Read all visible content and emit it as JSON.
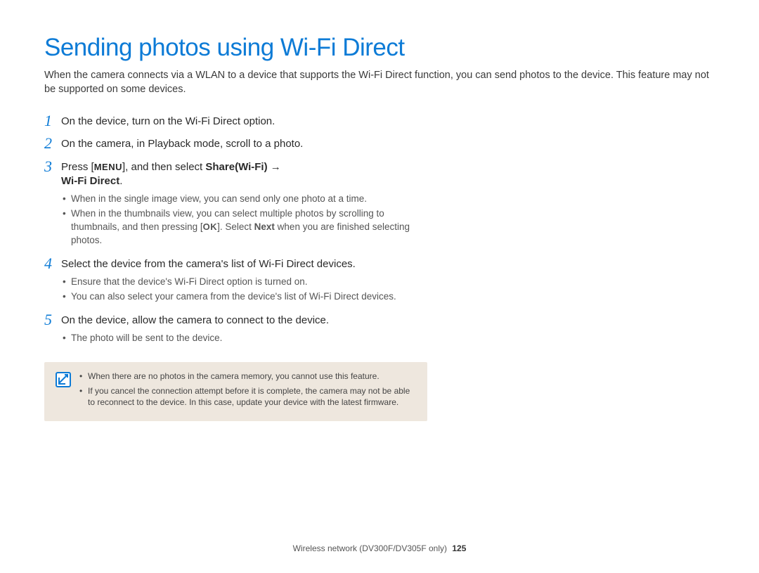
{
  "title": "Sending photos using Wi-Fi Direct",
  "intro": "When the camera connects via a WLAN to a device that supports the Wi-Fi Direct function, you can send photos to the device. This feature may not be supported on some devices.",
  "steps": {
    "s1": {
      "num": "1",
      "text": "On the device, turn on the Wi-Fi Direct option."
    },
    "s2": {
      "num": "2",
      "text": "On the camera, in Playback mode, scroll to a photo."
    },
    "s3": {
      "num": "3",
      "pre": "Press [",
      "menu": "MENU",
      "mid": "], and then select ",
      "strong1": "Share(Wi-Fi)",
      "arrow": " → ",
      "strong2": "Wi-Fi Direct",
      "post": ".",
      "bullets": {
        "b1": "When in the single image view, you can send only one photo at a time.",
        "b2a": "When in the thumbnails view, you can select multiple photos by scrolling to thumbnails, and then pressing [",
        "b2ok": "OK",
        "b2b": "]. Select ",
        "b2next": "Next",
        "b2c": " when you are finished selecting photos."
      }
    },
    "s4": {
      "num": "4",
      "text": "Select the device from the camera's list of Wi-Fi Direct devices.",
      "bullets": {
        "b1": "Ensure that the device's Wi-Fi Direct option is turned on.",
        "b2": "You can also select your camera from the device's list of Wi-Fi Direct devices."
      }
    },
    "s5": {
      "num": "5",
      "text": "On the device, allow the camera to connect to the device.",
      "bullets": {
        "b1": "The photo will be sent to the device."
      }
    }
  },
  "notes": {
    "n1": "When there are no photos in the camera memory, you cannot use this feature.",
    "n2": "If you cancel the connection attempt before it is complete, the camera may not be able to reconnect to the device. In this case, update your device with the latest firmware."
  },
  "footer": {
    "section": "Wireless network (DV300F/DV305F only)",
    "page": "125"
  }
}
